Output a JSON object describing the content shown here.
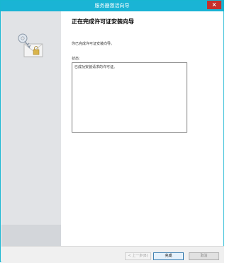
{
  "window": {
    "title": "服务器激活向导",
    "close_label": "×"
  },
  "sidebar": {
    "graphic": "wizard-key-certificate-icon"
  },
  "content": {
    "heading": "正在完成许可证安装向导",
    "intro": "你已完成许可证安装向导。",
    "status_label": "状态:",
    "status_text": "已成功安装请求的许可证。"
  },
  "footer": {
    "back_label": "< 上一步(B)",
    "finish_label": "完成",
    "cancel_label": "取消"
  },
  "colors": {
    "titlebar": "#1ab4d5",
    "close": "#c7302b",
    "sidebar": "#e1e3e6"
  }
}
